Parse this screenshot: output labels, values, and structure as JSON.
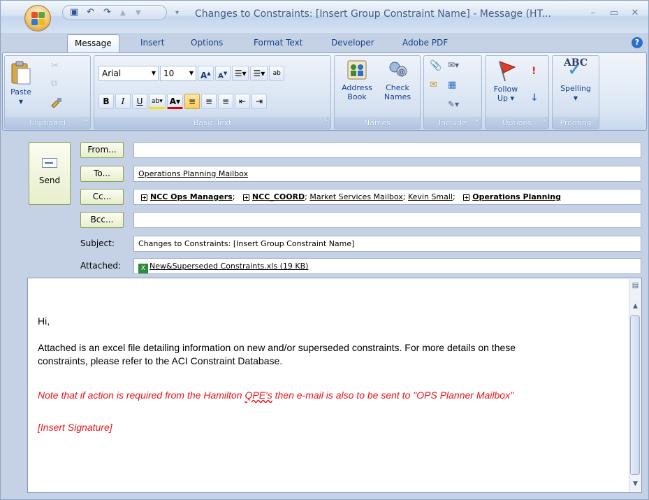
{
  "window": {
    "title": "Changes to Constraints: [Insert Group Constraint Name] - Message (HT...",
    "minimize_icon": "minimize-icon",
    "maximize_icon": "maximize-icon",
    "close_icon": "close-icon"
  },
  "quick_access": {
    "icons": [
      "save-icon",
      "undo-icon",
      "redo-icon",
      "previous-item-icon",
      "next-item-icon",
      "customize-dropdown-icon"
    ]
  },
  "tabs": [
    {
      "label": "Message",
      "active": true
    },
    {
      "label": "Insert"
    },
    {
      "label": "Options"
    },
    {
      "label": "Format Text"
    },
    {
      "label": "Developer"
    },
    {
      "label": "Adobe PDF"
    }
  ],
  "ribbon": {
    "clipboard": {
      "label": "Clipboard",
      "paste": "Paste"
    },
    "basic_text": {
      "label": "Basic Text",
      "font": "Arial",
      "size": "10",
      "bold": "B",
      "italic": "I",
      "underline": "U"
    },
    "names": {
      "label": "Names",
      "address_book_1": "Address",
      "address_book_2": "Book",
      "check_names_1": "Check",
      "check_names_2": "Names"
    },
    "include": {
      "label": "Include"
    },
    "options": {
      "label": "Options",
      "follow_up_1": "Follow",
      "follow_up_2": "Up ▾"
    },
    "proofing": {
      "label": "Proofing",
      "spelling": "Spelling",
      "abc": "ABC"
    }
  },
  "header": {
    "send": "Send",
    "from_btn": "From...",
    "to_btn": "To...",
    "cc_btn": "Cc...",
    "bcc_btn": "Bcc...",
    "subject_label": "Subject:",
    "attached_label": "Attached:",
    "from_value": "",
    "to_value": "Operations Planning Mailbox",
    "cc": {
      "g1": "NCC Ops Managers",
      "g2": "NCC_COORD",
      "p1": "Market Services Mailbox",
      "p2": "Kevin Small",
      "g3": "Operations Planning"
    },
    "bcc_value": "",
    "subject_value": "Changes to Constraints: [Insert Group Constraint Name]",
    "attachment": "New&Superseded Constraints.xls (19 KB)"
  },
  "body": {
    "greeting": "Hi,",
    "para1_line1": "Attached is an excel file detailing information on new and/or superseded constraints. For more details on these",
    "para1_line2": "constraints, please refer to the ACI Constraint Database.",
    "note_pre": "Note that if action is required from the Hamilton ",
    "note_word": "QPE's",
    "note_post": " then e-mail is also to be sent to \"OPS Planner Mailbox\"",
    "signature": "[Insert Signature]"
  }
}
